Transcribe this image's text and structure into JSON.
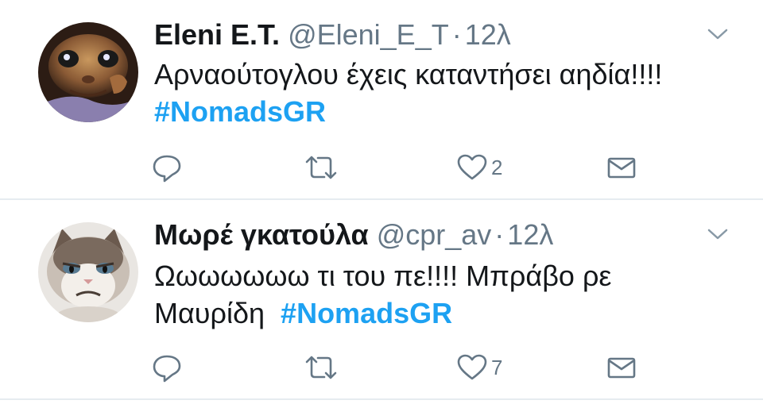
{
  "tweets": [
    {
      "name": "Eleni E.T.",
      "handle": "@Eleni_E_T",
      "separator": "·",
      "time": "12λ",
      "text": "Αρναούτογλου έχεις καταντήσει αηδία!!!!",
      "hashtag": "#NomadsGR",
      "likes": "2",
      "avatar_icon": "et-avatar-icon"
    },
    {
      "name": "Μωρέ γκατούλα",
      "handle": "@cpr_av",
      "separator": "·",
      "time": "12λ",
      "text_line1": "Ωωωωωωω τι του πε!!!! Μπράβο ρε",
      "text_line2": "Μαυρίδη",
      "hashtag": "#NomadsGR",
      "likes": "7",
      "avatar_icon": "grumpy-cat-avatar-icon"
    }
  ],
  "colors": {
    "name": "#14171a",
    "meta": "#657786",
    "hashtag": "#1da1f2",
    "divider": "#e6ecf0"
  }
}
